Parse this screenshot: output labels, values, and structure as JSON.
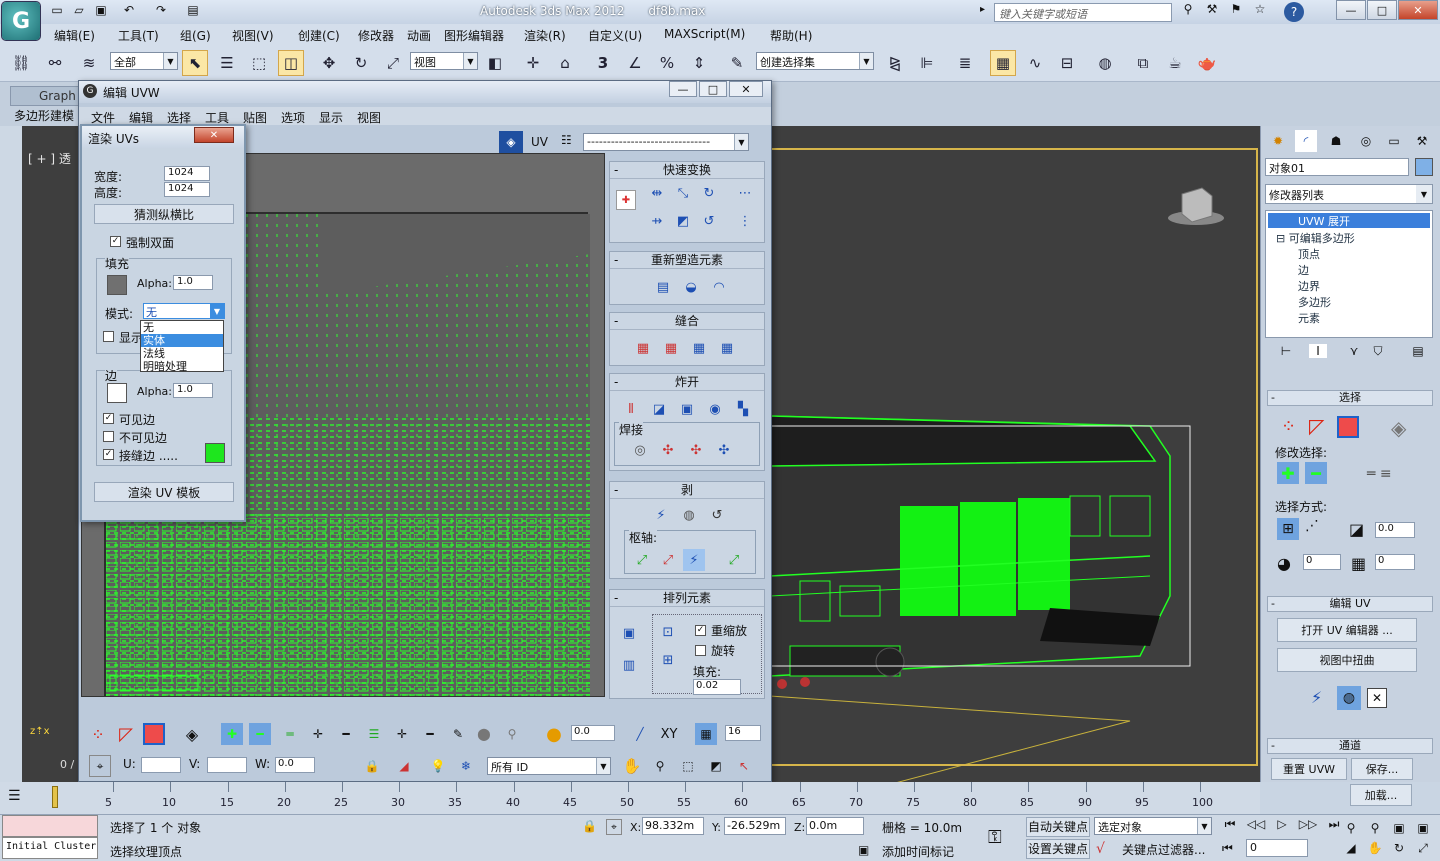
{
  "app": {
    "title": "Autodesk 3ds Max  2012",
    "filename": "df8b.max",
    "logo_letter": "G",
    "search_placeholder": "键入关键字或短语",
    "win_min": "—",
    "win_max": "□",
    "win_close": "✕"
  },
  "menubar": [
    "编辑(E)",
    "工具(T)",
    "组(G)",
    "视图(V)",
    "创建(C)",
    "修改器",
    "动画",
    "图形编辑器",
    "渲染(R)",
    "自定义(U)",
    "MAXScript(M)",
    "帮助(H)"
  ],
  "toolbar": {
    "selection_filter": "全部",
    "reference_coord": "视图",
    "named_selection": "创建选择集",
    "snap_3": "3",
    "snap_angle": "∠",
    "snap_percent": "%"
  },
  "ribbon": {
    "tab": "Graph",
    "subtab": "多边形建模"
  },
  "viewport": {
    "label": "[ + ] 透",
    "accent_color": "#d6b54a",
    "frame_label": "0 /"
  },
  "uvw_editor": {
    "title": "编辑 UVW",
    "menus": [
      "文件",
      "编辑",
      "选择",
      "工具",
      "贴图",
      "选项",
      "显示",
      "视图"
    ],
    "uv_label": "UV",
    "map_dropdown": "-------------------------------",
    "groups": {
      "quick_transform": "快速变换",
      "reshape": "重新塑造元素",
      "stitch": "缝合",
      "explode": "炸开",
      "weld": "焊接",
      "peel": "剥",
      "pivot": "枢轴:",
      "arrange": "排列元素",
      "rescale": "重缩放",
      "rotate": "旋转",
      "padding_label": "填充:",
      "padding_value": "0.02"
    },
    "bottom": {
      "spin_val": "0.0",
      "xy": "XY",
      "num": "16",
      "u_label": "U:",
      "v_label": "V:",
      "w_label": "W:",
      "w_value": "0.0",
      "id_filter": "所有 ID"
    }
  },
  "render_uvs": {
    "title": "渲染 UVs",
    "close": "✕",
    "width_label": "宽度:",
    "width_value": "1024",
    "height_label": "高度:",
    "height_value": "1024",
    "guess_aspect": "猜测纵横比",
    "force_double": "强制双面",
    "fill_label": "填充",
    "alpha_label": "Alpha:",
    "fill_alpha": "1.0",
    "mode_label": "模式:",
    "mode_value": "无",
    "mode_options": [
      "无",
      "实体",
      "法线",
      "明暗处理"
    ],
    "mode_selected_index": 1,
    "show_label": "显示",
    "edge_label": "边",
    "edge_alpha": "1.0",
    "visible_edges": "可见边",
    "invisible_edges": "不可见边",
    "seam_edges": "接缝边 .....",
    "seam_color": "#1ee61e",
    "render_template": "渲染 UV 模板"
  },
  "command_panel": {
    "object_name": "对象01",
    "modifier_list": "修改器列表",
    "stack": [
      "UVW 展开",
      "可编辑多边形",
      "顶点",
      "边",
      "边界",
      "多边形",
      "元素"
    ],
    "selection_title": "选择",
    "modify_selection": "修改选择:",
    "select_by": "选择方式:",
    "spin_a": "0.0",
    "spin_b": "0",
    "spin_c": "0",
    "edit_uv_title": "编辑 UV",
    "open_uv_editor": "打开 UV 编辑器 ...",
    "tweak_in_view": "视图中扭曲",
    "channel_title": "通道",
    "reset_uvw": "重置 UVW",
    "save": "保存...",
    "load": "加载..."
  },
  "timeline": {
    "ticks": [
      "5",
      "10",
      "15",
      "20",
      "25",
      "30",
      "35",
      "40",
      "45",
      "50",
      "55",
      "60",
      "65",
      "70",
      "75",
      "80",
      "85",
      "90",
      "95",
      "100"
    ]
  },
  "status": {
    "cluster_label": "Initial Cluster",
    "line1": "选择了 1 个 对象",
    "line2": "选择纹理顶点",
    "x_label": "X:",
    "x_value": "98.332m",
    "y_label": "Y:",
    "y_value": "-26.529m",
    "z_label": "Z:",
    "z_value": "0.0m",
    "grid": "栅格 = 10.0m",
    "auto_key": "自动关键点",
    "set_key": "设置关键点",
    "key_mode": "选定对象",
    "key_filter": "关键点过滤器...",
    "add_time_tag": "添加时间标记",
    "frame_value": "0"
  }
}
